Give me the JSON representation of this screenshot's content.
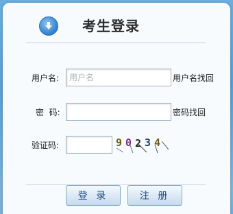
{
  "header": {
    "title": "考生登录",
    "icon": "down-arrow-circle-icon"
  },
  "form": {
    "username_label": "用户名:",
    "username_placeholder": "用户名",
    "username_recover": "用户名找回",
    "password_label": "密  码:",
    "password_recover": "密码找回",
    "captcha_label": "验证码:",
    "captcha_text": "90234"
  },
  "buttons": {
    "login": "登 录",
    "register": "注 册"
  },
  "colors": {
    "accent": "#2f7fcf",
    "background": "#4f9ad2"
  }
}
